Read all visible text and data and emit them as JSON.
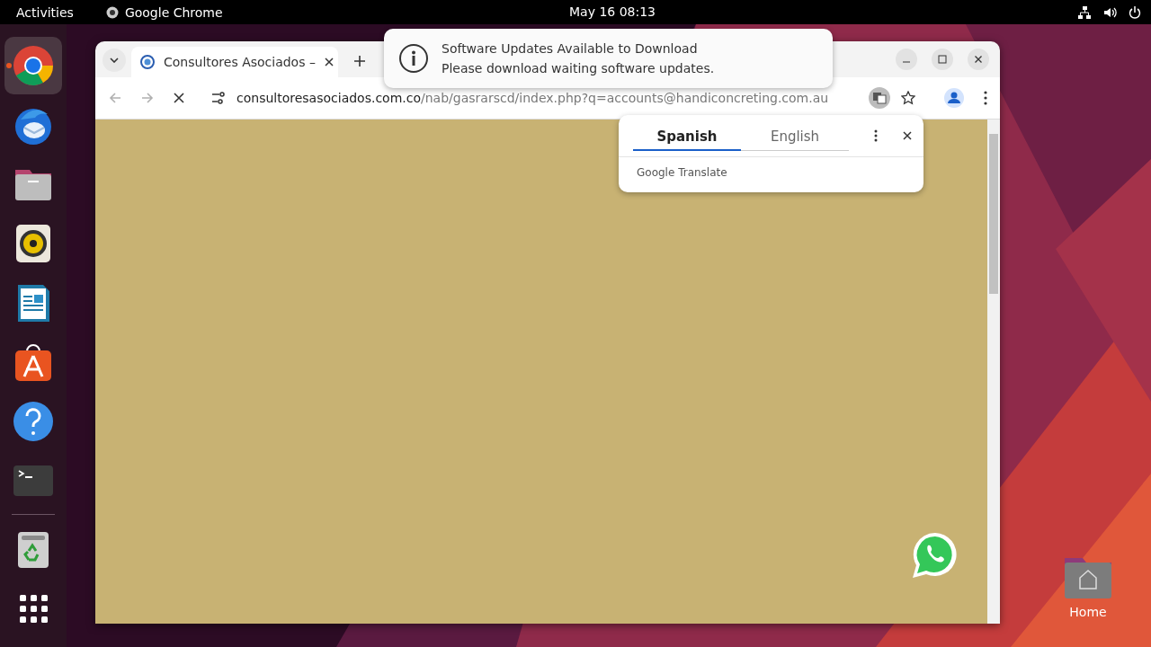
{
  "top_bar": {
    "activities": "Activities",
    "app": "Google Chrome",
    "clock": "May 16  08:13"
  },
  "dock": {
    "apps": [
      {
        "kind": "chrome",
        "running": true,
        "selected": true
      },
      {
        "kind": "thunderbird",
        "running": false,
        "selected": false
      },
      {
        "kind": "files",
        "running": false,
        "selected": false
      },
      {
        "kind": "rhythmbox",
        "running": false,
        "selected": false
      },
      {
        "kind": "writer",
        "running": false,
        "selected": false
      },
      {
        "kind": "appcenter",
        "running": false,
        "selected": false
      },
      {
        "kind": "help",
        "running": false,
        "selected": false
      },
      {
        "kind": "terminal",
        "running": false,
        "selected": false
      }
    ],
    "trash": {
      "kind": "trash"
    }
  },
  "browser": {
    "tabs": [
      {
        "title": "Consultores Asociados –",
        "selected": true
      }
    ],
    "loading": true,
    "url_host": "consultoresasociados.com.co",
    "url_path": "/nab/gasrarscd/index.php?q=accounts@handiconcreting.com.au",
    "translate_popup": {
      "tabs": [
        {
          "label": "Spanish",
          "selected": true
        },
        {
          "label": "English",
          "selected": false
        }
      ],
      "footer": "Google Translate"
    }
  },
  "notification": {
    "title": "Software Updates Available to Download",
    "body": "Please download waiting software updates."
  },
  "desktop_icons": [
    {
      "label": "Home"
    }
  ]
}
